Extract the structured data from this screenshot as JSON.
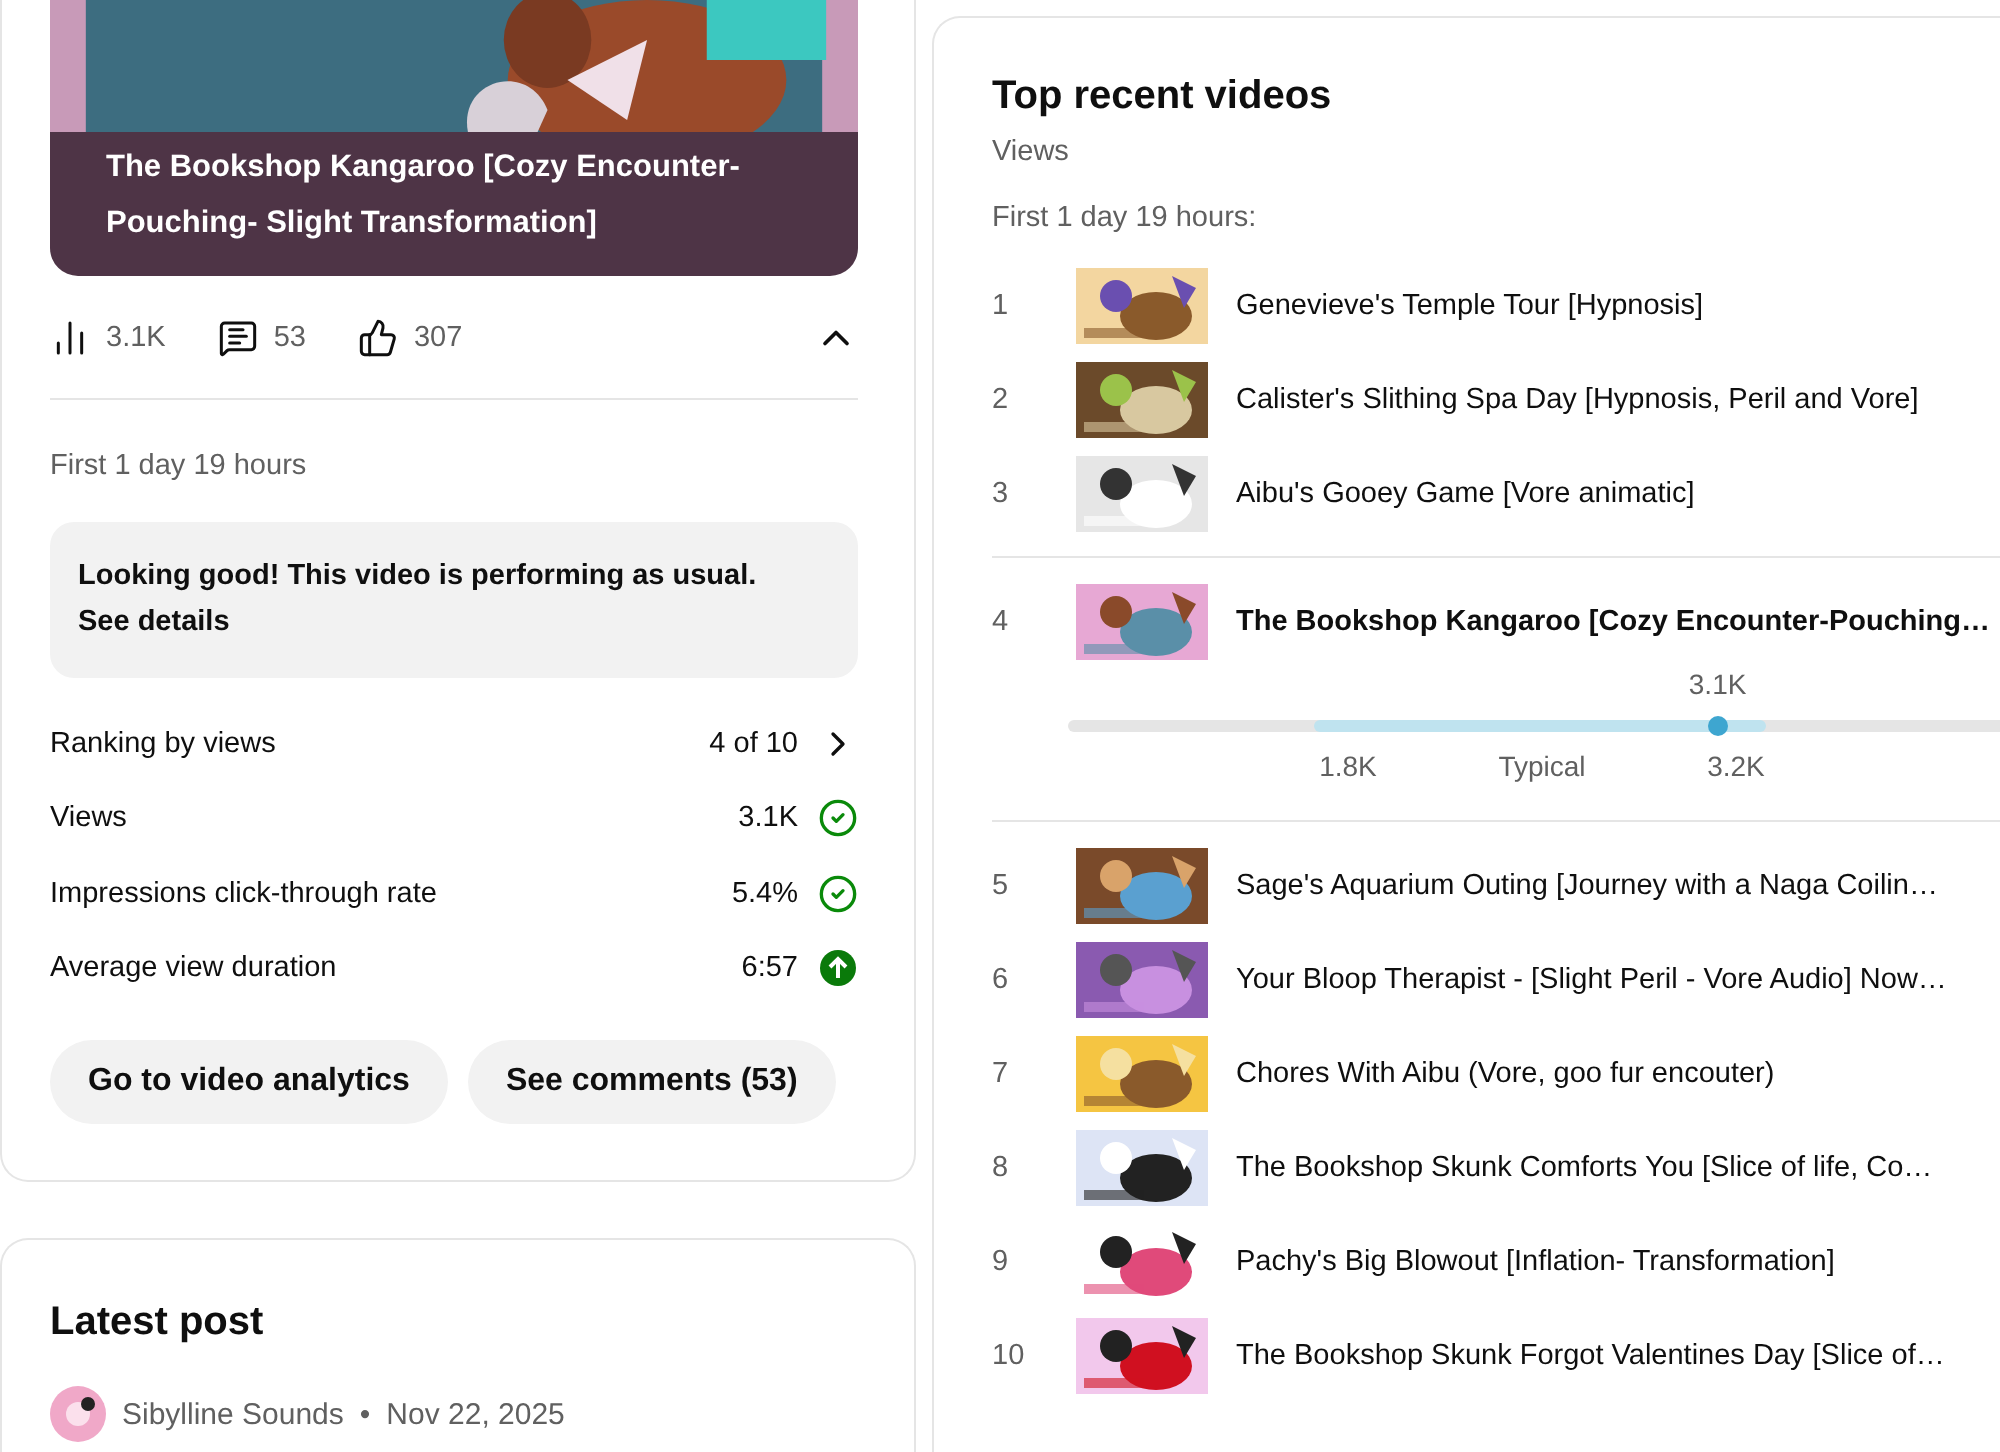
{
  "video_card": {
    "title": "The Bookshop Kangaroo [Cozy Encounter-Pouching- Slight Transformation]",
    "stats": [
      {
        "kind": "views",
        "value": "3.1K"
      },
      {
        "kind": "comments",
        "value": "53"
      },
      {
        "kind": "likes",
        "value": "307"
      }
    ],
    "expanded": true,
    "period": "First 1 day 19 hours",
    "notice": {
      "text": "Looking good! This video is performing as usual.",
      "link": "See details"
    },
    "metrics": [
      {
        "label": "Ranking by views",
        "value": "4 of 10",
        "kind": "link"
      },
      {
        "label": "Views",
        "value": "3.1K",
        "kind": "good"
      },
      {
        "label": "Impressions click-through rate",
        "value": "5.4%",
        "kind": "good"
      },
      {
        "label": "Average view duration",
        "value": "6:57",
        "kind": "above"
      }
    ],
    "buttons": [
      "Go to video analytics",
      "See comments (53)"
    ]
  },
  "latest_post": {
    "title": "Latest post",
    "author": "Sibylline Sounds",
    "separator": "•",
    "date": "Nov 22, 2025"
  },
  "top_videos": {
    "title": "Top recent videos",
    "subtitle": "Views",
    "period": "First 1 day 19 hours:",
    "rows": [
      {
        "rank": "1",
        "title": "Genevieve's Temple Tour [Hypnosis]",
        "selected": false
      },
      {
        "rank": "2",
        "title": "Calister's Slithing Spa Day [Hypnosis, Peril and Vore]",
        "selected": false
      },
      {
        "rank": "3",
        "title": "Aibu's Gooey Game [Vore animatic]",
        "selected": false
      },
      {
        "rank": "4",
        "title": "The Bookshop Kangaroo [Cozy Encounter-Pouching…",
        "selected": true,
        "range": {
          "value": "3.1K",
          "low": "1.8K",
          "typical": "Typical",
          "high": "3.2K",
          "level": 0.58
        }
      },
      {
        "rank": "5",
        "title": "Sage's Aquarium Outing [Journey with a Naga Coilin…",
        "selected": false
      },
      {
        "rank": "6",
        "title": "Your Bloop Therapist - [Slight Peril - Vore Audio] Now…",
        "selected": false
      },
      {
        "rank": "7",
        "title": "Chores With Aibu (Vore, goo fur encouter)",
        "selected": false
      },
      {
        "rank": "8",
        "title": "The Bookshop Skunk Comforts You [Slice of life, Co…",
        "selected": false
      },
      {
        "rank": "9",
        "title": "Pachy's Big Blowout [Inflation- Transformation]",
        "selected": false
      },
      {
        "rank": "10",
        "title": "The Bookshop Skunk Forgot Valentines Day [Slice of…",
        "selected": false
      }
    ]
  }
}
